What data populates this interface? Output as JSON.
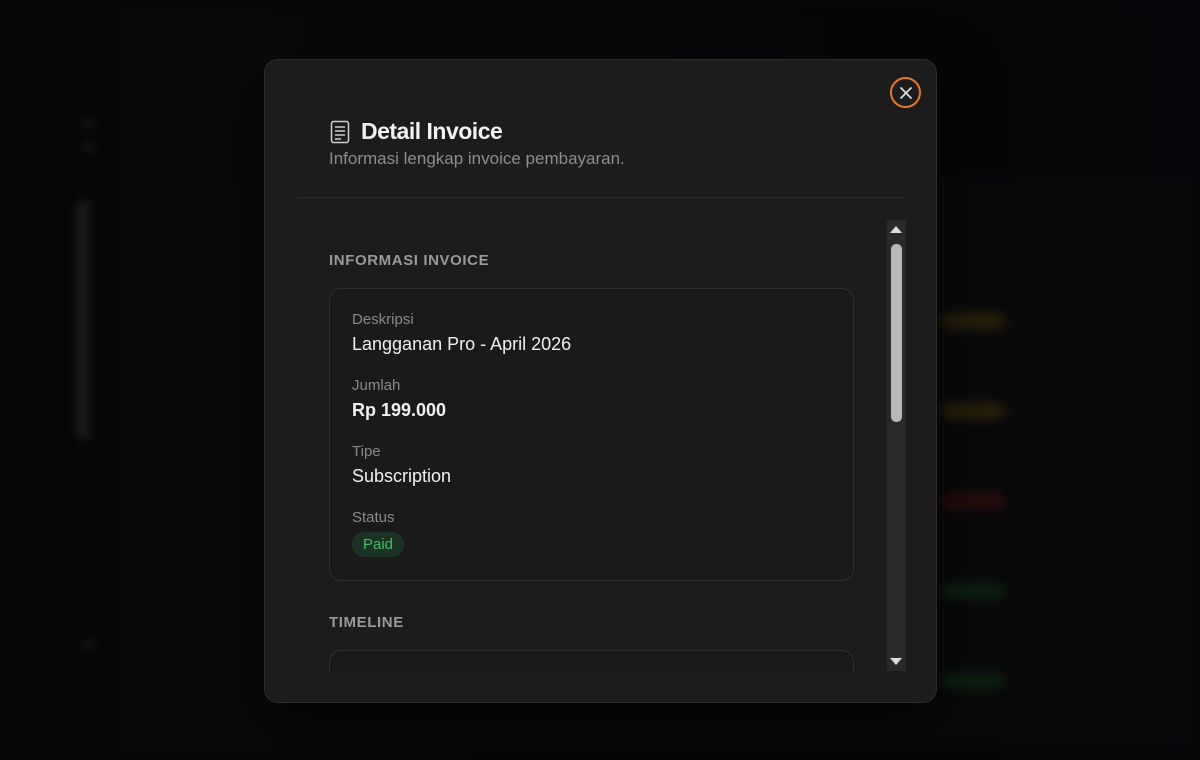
{
  "modal": {
    "title": "Detail Invoice",
    "subtitle": "Informasi lengkap invoice pembayaran.",
    "close_icon": "close-icon",
    "title_icon": "document-icon",
    "sections": {
      "invoice_info": {
        "label": "INFORMASI INVOICE",
        "fields": {
          "description": {
            "label": "Deskripsi",
            "value": "Langganan Pro - April 2026"
          },
          "amount": {
            "label": "Jumlah",
            "value": "Rp 199.000"
          },
          "type": {
            "label": "Tipe",
            "value": "Subscription"
          },
          "status": {
            "label": "Status",
            "value": "Paid"
          }
        }
      },
      "timeline": {
        "label": "TIMELINE"
      }
    }
  },
  "colors": {
    "accent_focus": "#e37a2a",
    "status_paid_text": "#3fbf62",
    "status_paid_bg": "#1b3324",
    "modal_bg": "#1c1c1c"
  }
}
